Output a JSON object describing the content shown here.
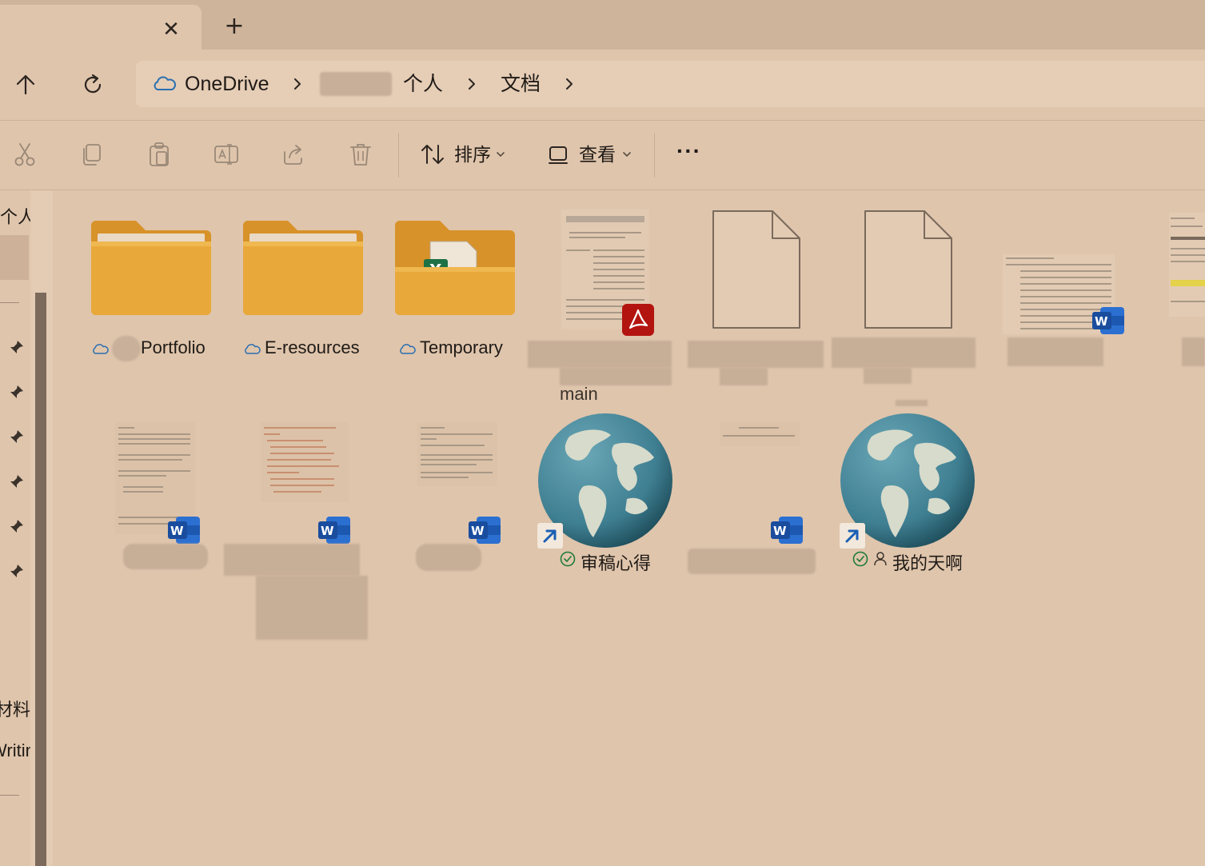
{
  "tabs": {
    "new_tab_symbol": "+"
  },
  "breadcrumb": {
    "root": "OneDrive",
    "items": [
      "个人",
      "文档"
    ]
  },
  "toolbar": {
    "sort_label": "排序",
    "view_label": "查看",
    "more_label": "···"
  },
  "sidebar": {
    "top_label": "个人",
    "bottom_items": [
      "材料",
      "Writing"
    ]
  },
  "files": [
    {
      "name": "Portfolio",
      "type": "folder"
    },
    {
      "name": "E-resources",
      "type": "folder"
    },
    {
      "name": "Temporary",
      "type": "folder-with-excel"
    },
    {
      "name": "",
      "type": "pdf"
    },
    {
      "name": "",
      "type": "file"
    },
    {
      "name": "",
      "type": "file"
    },
    {
      "name": "",
      "type": "word"
    },
    {
      "name": "",
      "type": "word"
    },
    {
      "name": "",
      "type": "word"
    },
    {
      "name": "",
      "type": "word"
    },
    {
      "name": "审稿心得",
      "type": "shortcut",
      "status": "synced"
    },
    {
      "name": "",
      "type": "word"
    },
    {
      "name": "我的天啊",
      "type": "shortcut",
      "status": "synced-shared"
    }
  ],
  "partial_label": "main",
  "colors": {
    "background": "#dfc5ac",
    "folder": "#e9a93a",
    "word_blue": "#1f5fb8",
    "pdf_red": "#b3140f",
    "globe_water": "#3f7f92",
    "globe_land": "#d7dbcb"
  }
}
